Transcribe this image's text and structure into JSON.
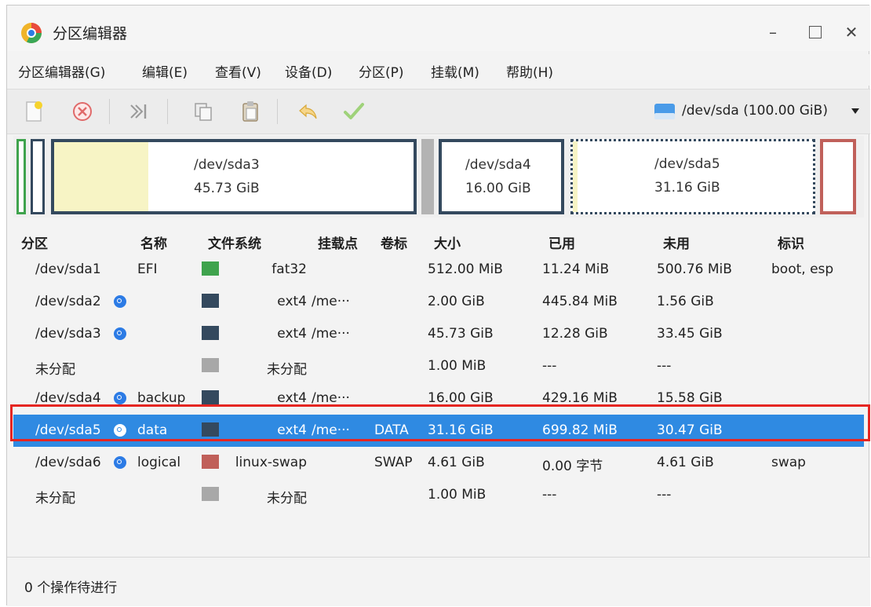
{
  "window": {
    "title": "分区编辑器",
    "minimize": "–",
    "close": "✕"
  },
  "menu": [
    "分区编辑器(G)",
    "编辑(E)",
    "查看(V)",
    "设备(D)",
    "分区(P)",
    "挂载(M)",
    "帮助(H)"
  ],
  "toolbar": {
    "icons": [
      "new-partition-icon",
      "delete-icon",
      "resize-move-icon",
      "copy-icon",
      "paste-icon",
      "undo-icon",
      "apply-icon"
    ],
    "device": "/dev/sda (100.00 GiB)"
  },
  "partition_map": {
    "sda3": {
      "name": "/dev/sda3",
      "size": "45.73 GiB"
    },
    "sda4": {
      "name": "/dev/sda4",
      "size": "16.00 GiB"
    },
    "sda5": {
      "name": "/dev/sda5",
      "size": "31.16 GiB"
    }
  },
  "table": {
    "headers": [
      "分区",
      "名称",
      "文件系统",
      "挂载点",
      "卷标",
      "大小",
      "已用",
      "未用",
      "标识"
    ],
    "rows": [
      {
        "partition": "/dev/sda1",
        "name": "EFI",
        "fs": "fat32",
        "mount": "",
        "label": "",
        "size": "512.00 MiB",
        "used": "11.24 MiB",
        "unused": "500.76 MiB",
        "flags": "boot, esp",
        "color": "#3fa34d",
        "mounted": false
      },
      {
        "partition": "/dev/sda2",
        "name": "",
        "fs": "ext4",
        "mount": "/me···",
        "label": "",
        "size": "2.00 GiB",
        "used": "445.84 MiB",
        "unused": "1.56 GiB",
        "flags": "",
        "color": "#34495e",
        "mounted": true
      },
      {
        "partition": "/dev/sda3",
        "name": "",
        "fs": "ext4",
        "mount": "/me···",
        "label": "",
        "size": "45.73 GiB",
        "used": "12.28 GiB",
        "unused": "33.45 GiB",
        "flags": "",
        "color": "#34495e",
        "mounted": true
      },
      {
        "partition": "未分配",
        "name": "",
        "fs": "未分配",
        "mount": "",
        "label": "",
        "size": "1.00 MiB",
        "used": "---",
        "unused": "---",
        "flags": "",
        "color": "#a8a8a8",
        "mounted": false
      },
      {
        "partition": "/dev/sda4",
        "name": "backup",
        "fs": "ext4",
        "mount": "/me···",
        "label": "",
        "size": "16.00 GiB",
        "used": "429.16 MiB",
        "unused": "15.58 GiB",
        "flags": "",
        "color": "#34495e",
        "mounted": true
      },
      {
        "partition": "/dev/sda5",
        "name": "data",
        "fs": "ext4",
        "mount": "/me···",
        "label": "DATA",
        "size": "31.16 GiB",
        "used": "699.82 MiB",
        "unused": "30.47 GiB",
        "flags": "",
        "color": "#34495e",
        "mounted": true,
        "selected": true
      },
      {
        "partition": "/dev/sda6",
        "name": "logical",
        "fs": "linux-swap",
        "mount": "",
        "label": "SWAP",
        "size": "4.61 GiB",
        "used": "0.00 字节",
        "unused": "4.61 GiB",
        "flags": "swap",
        "color": "#c0605a",
        "mounted": true
      },
      {
        "partition": "未分配",
        "name": "",
        "fs": "未分配",
        "mount": "",
        "label": "",
        "size": "1.00 MiB",
        "used": "---",
        "unused": "---",
        "flags": "",
        "color": "#a8a8a8",
        "mounted": false
      }
    ]
  },
  "status": "0 个操作待进行",
  "colors": {
    "selection": "#2f8ae2",
    "highlight_outline": "#e52521",
    "ext4": "#34495e",
    "fat32": "#3fa34d",
    "swap": "#c0605a"
  }
}
